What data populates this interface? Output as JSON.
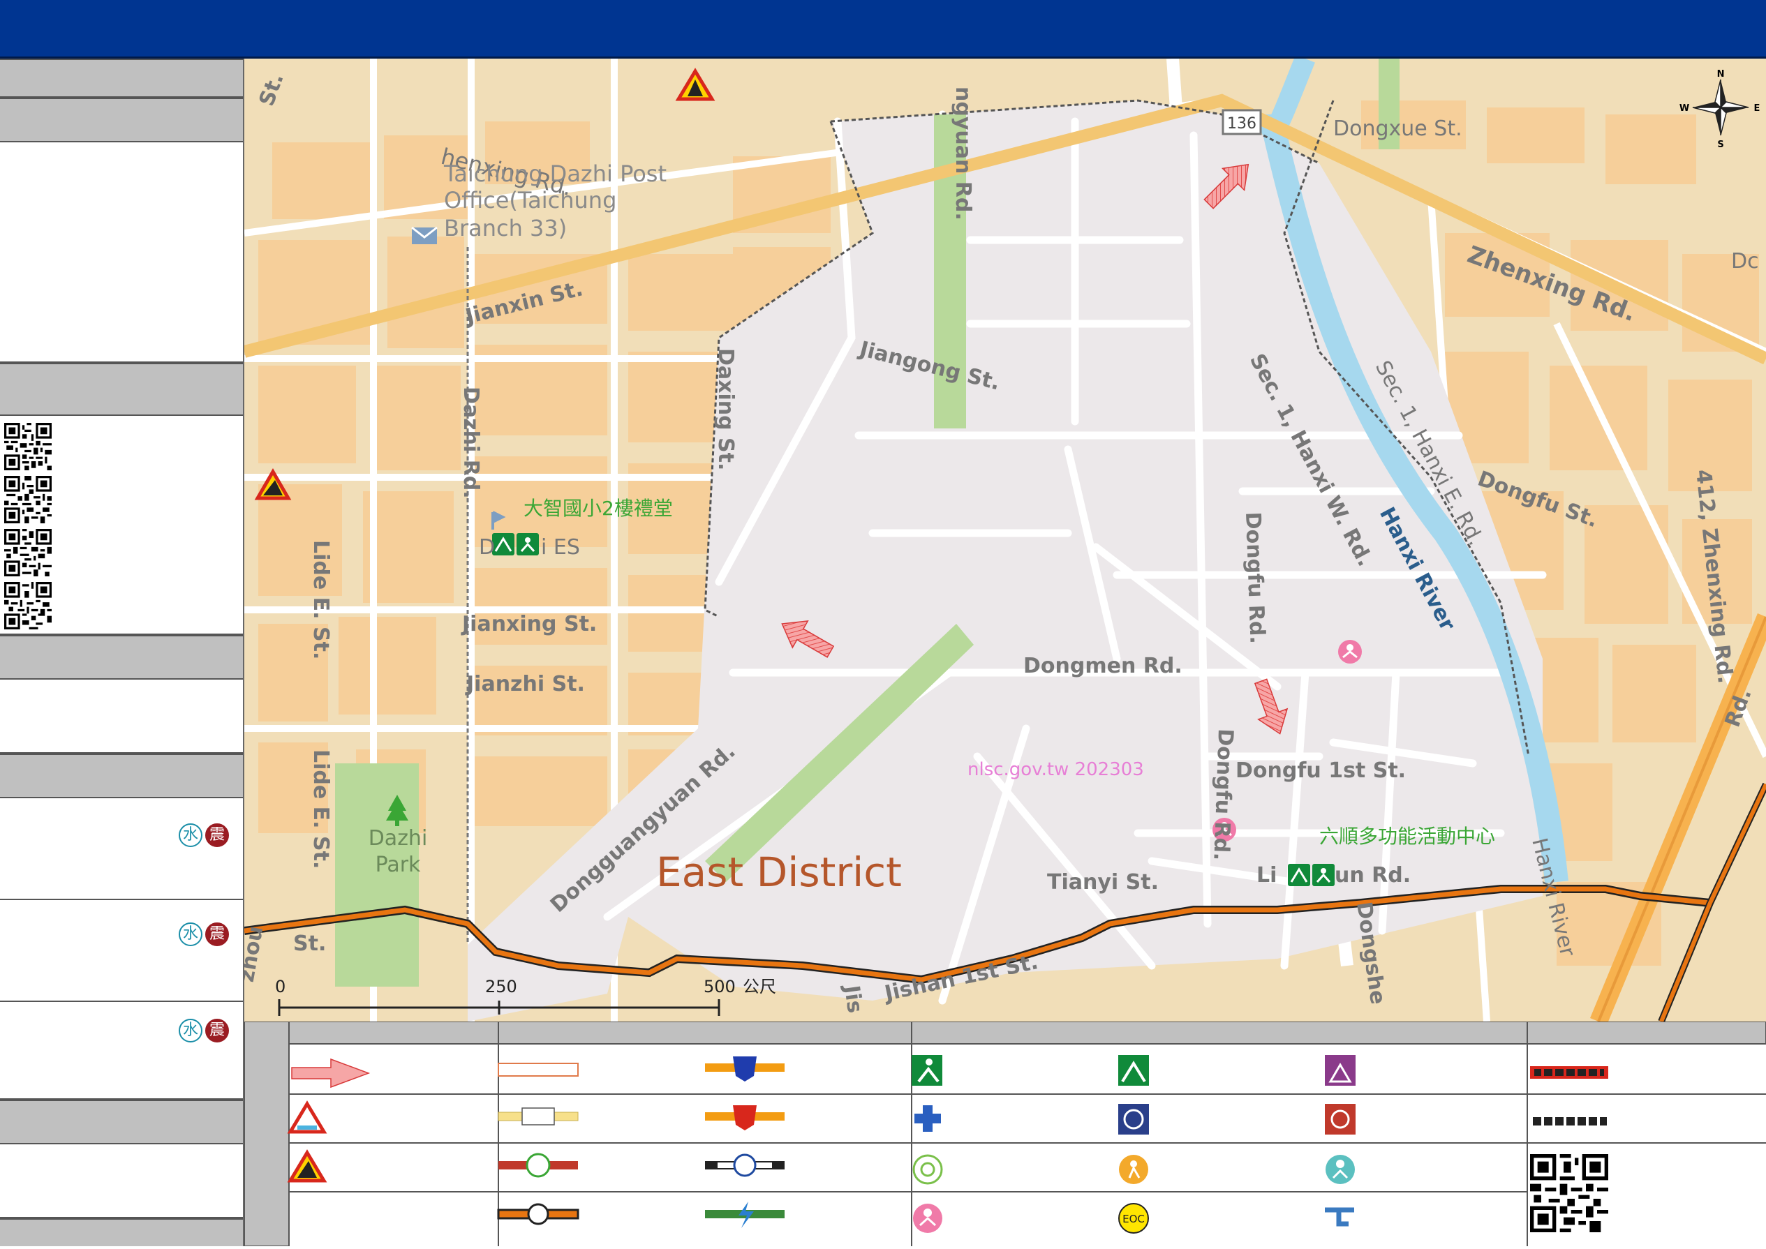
{
  "map": {
    "district_label": "East District",
    "watermark": "nlsc.gov.tw 202303",
    "route_shield": "136",
    "compass": {
      "n": "N",
      "s": "S",
      "e": "E",
      "w": "W"
    },
    "scale": {
      "ticks": [
        "0",
        "250",
        "500"
      ],
      "unit": "公尺"
    },
    "shelters": [
      {
        "name": "大智國小2樓禮堂",
        "school_label_a": "D",
        "school_label_b": "i ES"
      },
      {
        "name": "六順多功能活動中心"
      }
    ],
    "streets": {
      "zhenxing_w": "Zhenxing Rd.",
      "zhenxing_e": "Zhenxing Rd.",
      "dongxue": "Dongxue St.",
      "jianxin": "Jianxin St.",
      "jiangong": "Jiangong St.",
      "jianxing": "Jianxing St.",
      "jianzhi": "Jianzhi St.",
      "dazhi": "Dazhi Rd.",
      "daxing": "Daxing St.",
      "lide1": "Lide E. St.",
      "lide2": "Lide E. St.",
      "dongguangyuan_n": "ngyuan Rd.",
      "dongguangyuan": "Dongguangyuan Rd.",
      "hanxiw": "Sec. 1, Hanxi W. Rd.",
      "hanxie": "Sec. 1, Hanxi E. Rd.",
      "dongfu_st": "Dongfu St.",
      "dongfu_rd1": "Dongfu Rd.",
      "dongfu_rd2": "Dongfu Rd.",
      "dongmen": "Dongmen Rd.",
      "dongfu1": "Dongfu 1st St.",
      "tianyi": "Tianyi St.",
      "lishun_a": "Li",
      "lishun_b": "un Rd.",
      "jishan": "Jishan 1st St.",
      "hanxi_river1": "Hanxi River",
      "hanxi_river2": "Hanxi River",
      "zhenxing412": "412, Zhenxing Rd.",
      "st_nw": "St.",
      "zhou": "zhou",
      "st_sw": "St.",
      "dc": "Dc",
      "dongshe": "Dongshe",
      "jis": "Jis",
      "rd_e": "Rd.",
      "shenxing": "henxing Rd."
    },
    "poi": {
      "post_office_line1": "Taichung Dazhi Post",
      "post_office_line2": "Office(Taichung",
      "post_office_line3": "Branch 33)",
      "park_line1": "Dazhi",
      "park_line2": "Park"
    }
  },
  "sidebar": {
    "hazard_badges": [
      {
        "water": "水",
        "quake": "震"
      },
      {
        "water": "水",
        "quake": "震"
      },
      {
        "water": "水",
        "quake": "震"
      }
    ]
  },
  "legend": {
    "eoc_label": "EOC"
  },
  "colors": {
    "header": "#003591",
    "map_bg": "#f1deb8",
    "block": "#f6cf9a",
    "district": "#ece8ea",
    "road": "#ffffff",
    "green": "#b8d99a",
    "river": "#a6d8ee",
    "boundary": "#e87511",
    "shelter_text": "#3aa635",
    "district_text": "#b5562a"
  }
}
